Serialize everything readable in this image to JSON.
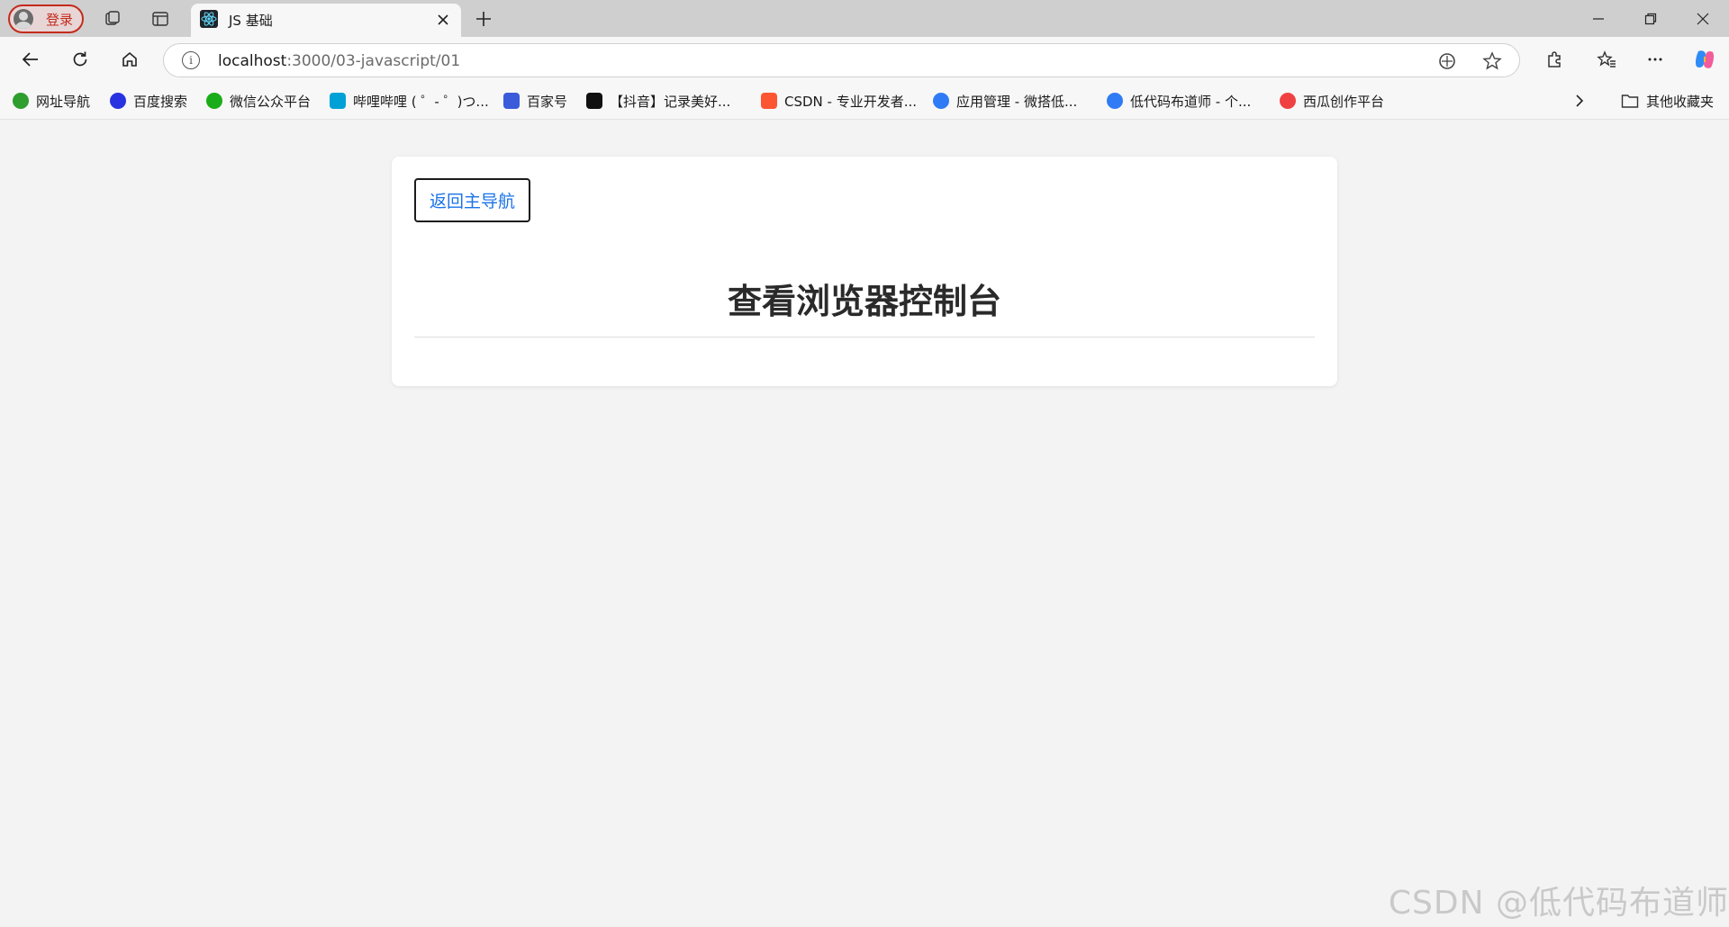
{
  "browser": {
    "profile_label": "登录",
    "tab": {
      "title": "JS 基础",
      "icon": "react-icon"
    },
    "address": {
      "host": "localhost",
      "path": ":3000/03-javascript/01"
    },
    "bookmarks": [
      {
        "label": "网址导航",
        "color": "#2e9e2e"
      },
      {
        "label": "百度搜索",
        "color": "#2932e1"
      },
      {
        "label": "微信公众平台",
        "color": "#1aad19"
      },
      {
        "label": "哔哩哔哩 ( ゜- ゜)つ...",
        "color": "#00a1d6"
      },
      {
        "label": "百家号",
        "color": "#3b5bdb"
      },
      {
        "label": "【抖音】记录美好...",
        "color": "#111111"
      },
      {
        "label": "CSDN - 专业开发者...",
        "color": "#fc5531"
      },
      {
        "label": "应用管理 - 微搭低...",
        "color": "#2f7bf6"
      },
      {
        "label": "低代码布道师 - 个...",
        "color": "#2f7bf6"
      },
      {
        "label": "西瓜创作平台",
        "color": "#f04142"
      }
    ],
    "other_favorites": "其他收藏夹"
  },
  "page": {
    "back_button_label": "返回主导航",
    "heading": "查看浏览器控制台"
  },
  "watermark": "CSDN @低代码布道师"
}
